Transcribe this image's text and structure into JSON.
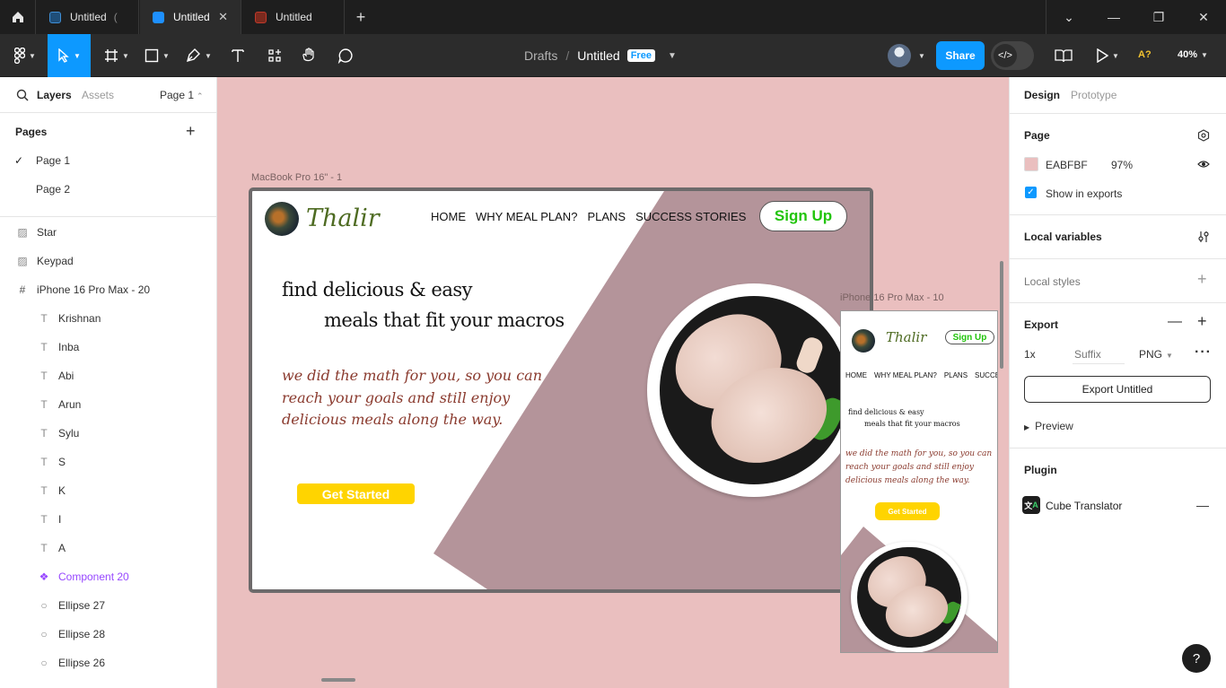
{
  "tabs": [
    {
      "label": "Untitled",
      "color": "#2b6cb0",
      "active": false,
      "suffix": "("
    },
    {
      "label": "Untitled",
      "color": "#1e90ff",
      "active": true
    },
    {
      "label": "Untitled",
      "color": "#c0392b",
      "active": false
    }
  ],
  "breadcrumb": {
    "folder": "Drafts",
    "sep": "/",
    "file": "Untitled",
    "badge": "Free"
  },
  "toolbar": {
    "share": "Share",
    "zoom": "40%",
    "a_label": "A?"
  },
  "left": {
    "tab_layers": "Layers",
    "tab_assets": "Assets",
    "page_selector": "Page 1",
    "pages_title": "Pages",
    "pages": [
      {
        "label": "Page 1",
        "selected": true
      },
      {
        "label": "Page 2",
        "selected": false
      }
    ],
    "layers": [
      {
        "label": "Star",
        "icon": "image-icon",
        "indent": 0
      },
      {
        "label": "Keypad",
        "icon": "image-icon",
        "indent": 0
      },
      {
        "label": "iPhone 16 Pro Max - 20",
        "icon": "frame-icon",
        "indent": 0
      },
      {
        "label": "Krishnan",
        "icon": "text-icon",
        "indent": 1
      },
      {
        "label": "Inba",
        "icon": "text-icon",
        "indent": 1
      },
      {
        "label": "Abi",
        "icon": "text-icon",
        "indent": 1
      },
      {
        "label": "Arun",
        "icon": "text-icon",
        "indent": 1
      },
      {
        "label": "Sylu",
        "icon": "text-icon",
        "indent": 1
      },
      {
        "label": "S",
        "icon": "text-icon",
        "indent": 1
      },
      {
        "label": "K",
        "icon": "text-icon",
        "indent": 1
      },
      {
        "label": "I",
        "icon": "text-icon",
        "indent": 1
      },
      {
        "label": "A",
        "icon": "text-icon",
        "indent": 1
      },
      {
        "label": "Component 20",
        "icon": "component-icon",
        "indent": 1
      },
      {
        "label": "Ellipse 27",
        "icon": "ellipse-icon",
        "indent": 1
      },
      {
        "label": "Ellipse 28",
        "icon": "ellipse-icon",
        "indent": 1
      },
      {
        "label": "Ellipse 26",
        "icon": "ellipse-icon",
        "indent": 1
      }
    ]
  },
  "canvas": {
    "bg": "#eabfbf",
    "frame1_label": "MacBook Pro 16\" - 1",
    "frame2_label": "iPhone 16 Pro Max - 10",
    "site": {
      "logo": "Thalir",
      "nav": [
        "HOME",
        "WHY MEAL PLAN?",
        "PLANS",
        "SUCCESS STORIES"
      ],
      "signup": "Sign Up",
      "headline1": "find delicious & easy",
      "headline2": "meals that fit your macros",
      "sub1": "we did the math for you, so you can",
      "sub2": "reach your goals and still enjoy",
      "sub3": "delicious meals along the way.",
      "cta": "Get Started",
      "mobile_nav": [
        "HOME",
        "WHY MEAL PLAN?",
        "PLANS",
        "SUCCE"
      ],
      "accent": "#ffd400",
      "signup_color": "#22c40c",
      "mauve": "#b4949a"
    }
  },
  "right": {
    "tab_design": "Design",
    "tab_prototype": "Prototype",
    "page_title": "Page",
    "page_color_hex": "EABFBF",
    "page_opacity": "97%",
    "show_exports": "Show in exports",
    "local_vars": "Local variables",
    "local_styles": "Local styles",
    "export_title": "Export",
    "export_scale": "1x",
    "export_suffix_ph": "Suffix",
    "export_format": "PNG",
    "export_button": "Export Untitled",
    "preview": "Preview",
    "plugin_title": "Plugin",
    "plugin_name": "Cube Translator"
  }
}
